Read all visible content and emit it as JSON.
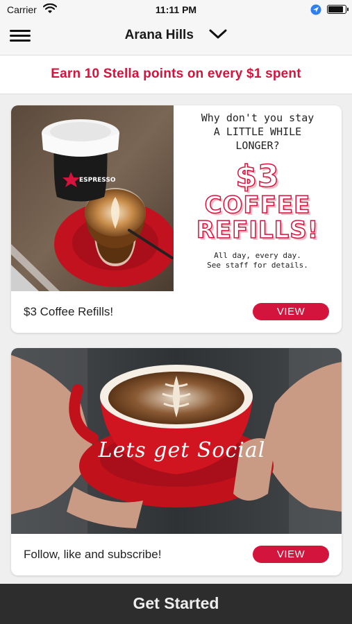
{
  "status_bar": {
    "carrier": "Carrier",
    "time": "11:11 PM",
    "battery_level": 0.9
  },
  "nav": {
    "store_name": "Arana Hills"
  },
  "promo_banner": {
    "text": "Earn 10 Stella points on every $1 spent"
  },
  "cards": [
    {
      "title": "$3 Coffee Refills!",
      "view_label": "VIEW",
      "promo": {
        "question_lines": [
          "Why don't you stay",
          "A LITTLE WHILE",
          "LONGER?"
        ],
        "price": "$3",
        "headline_lines": [
          "COFFEE",
          "REFILLS!"
        ],
        "fine_print_lines": [
          "All day, every day.",
          "See staff for details."
        ]
      },
      "cup_logo": "ESPRESSO"
    },
    {
      "title": "Follow, like and subscribe!",
      "view_label": "VIEW",
      "overlay_text": "Lets get Social"
    }
  ],
  "cta": {
    "label": "Get Started"
  },
  "colors": {
    "accent": "#d3143c",
    "cta_background": "#2d2d2d"
  }
}
